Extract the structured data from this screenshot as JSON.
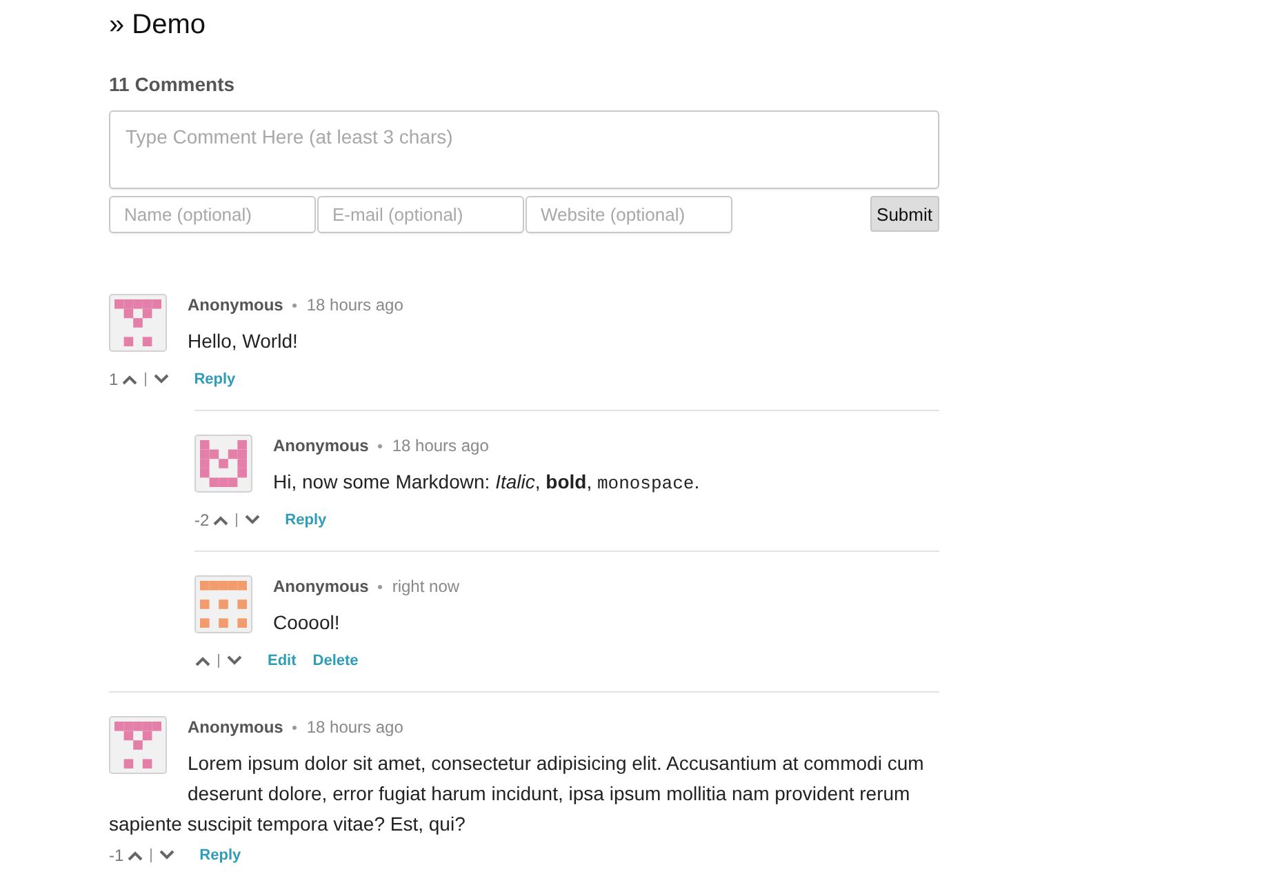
{
  "title": "» Demo",
  "comment_count": "11 Comments",
  "form": {
    "comment": {
      "placeholder": "Type Comment Here (at least 3 chars)"
    },
    "fields": [
      {
        "placeholder": "Name (optional)"
      },
      {
        "placeholder": "E-mail (optional)"
      },
      {
        "placeholder": "Website (optional)"
      }
    ],
    "submit": "Submit"
  },
  "comments": [
    {
      "author": "Anonymous",
      "time": "18 hours ago",
      "avatar": {
        "kind": "fork",
        "color": "#e37fa8"
      },
      "body": [
        {
          "kind": "text",
          "text": "Hello, World!"
        }
      ],
      "score": "1",
      "actions": [
        "Reply"
      ],
      "children": [
        {
          "author": "Anonymous",
          "time": "18 hours ago",
          "avatar": {
            "kind": "cup",
            "color": "#e37fa8"
          },
          "body": [
            {
              "kind": "text",
              "text": "Hi, now some Markdown: "
            },
            {
              "kind": "italic",
              "text": "Italic"
            },
            {
              "kind": "text",
              "text": ", "
            },
            {
              "kind": "bold",
              "text": "bold"
            },
            {
              "kind": "text",
              "text": ", "
            },
            {
              "kind": "code",
              "text": "monospace"
            },
            {
              "kind": "text",
              "text": "."
            }
          ],
          "score": "-2",
          "actions": [
            "Reply"
          ]
        },
        {
          "author": "Anonymous",
          "time": "right now",
          "avatar": {
            "kind": "grid",
            "color": "#f29c6e"
          },
          "body": [
            {
              "kind": "text",
              "text": "Cooool!"
            }
          ],
          "actions": [
            "Edit",
            "Delete"
          ]
        }
      ]
    },
    {
      "author": "Anonymous",
      "time": "18 hours ago",
      "avatar": {
        "kind": "fork",
        "color": "#e37fa8"
      },
      "body": [
        {
          "kind": "text",
          "text": "Lorem ipsum dolor sit amet, consectetur adipisicing elit. Accusantium at commodi cum deserunt dolore, error fugiat harum incidunt, ipsa ipsum mollitia nam provident rerum sapiente suscipit tempora vitae? Est, qui?"
        }
      ],
      "score": "-1",
      "actions": [
        "Reply"
      ]
    }
  ]
}
